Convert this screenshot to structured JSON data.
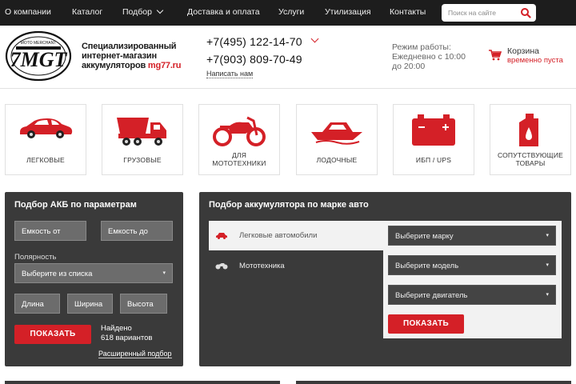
{
  "nav": {
    "items": [
      "О компании",
      "Каталог",
      "Подбор",
      "Доставка и оплата",
      "Услуги",
      "Утилизация",
      "Контакты"
    ],
    "search_placeholder": "Поиск на сайте"
  },
  "header": {
    "logo_text": "7MGT",
    "logo_arc_text": "MOTO MERCHANT",
    "tagline_line1": "Специализированный",
    "tagline_line2": "интернет-магазин",
    "tagline_line3_prefix": "аккумуляторов ",
    "tagline_line3_brand": "mg77.ru",
    "phone1": "+7(495) 122-14-70",
    "phone2": "+7(903) 809-70-49",
    "write_us": "Написать нам",
    "hours_line1": "Режим работы:",
    "hours_line2": "Ежедневно с 10:00",
    "hours_line3": "до 20:00",
    "cart_title": "Корзина",
    "cart_status": "временно пуста"
  },
  "categories": [
    {
      "label1": "ЛЕГКОВЫЕ",
      "label2": ""
    },
    {
      "label1": "ГРУЗОВЫЕ",
      "label2": ""
    },
    {
      "label1": "ДЛЯ",
      "label2": "МОТОТЕХНИКИ"
    },
    {
      "label1": "ЛОДОЧНЫЕ",
      "label2": ""
    },
    {
      "label1": "ИБП / UPS",
      "label2": ""
    },
    {
      "label1": "СОПУТСТВУЮЩИЕ",
      "label2": "ТОВАРЫ"
    }
  ],
  "param_panel": {
    "title": "Подбор АКБ по параметрам",
    "capacity_from": "Емкость от",
    "capacity_to": "Емкость до",
    "polarity_label": "Полярность",
    "polarity_value": "Выберите из списка",
    "length": "Длина",
    "width": "Ширина",
    "height": "Высота",
    "show_button": "ПОКАЗАТЬ",
    "found_line1": "Найдено",
    "found_line2": "618 вариантов",
    "extended_link": "Расширенный подбор"
  },
  "brand_panel": {
    "title": "Подбор аккумулятора по марке авто",
    "tab_cars": "Легковые автомобили",
    "tab_moto": "Мототехника",
    "select_brand": "Выберите марку",
    "select_model": "Выберите модель",
    "select_engine": "Выберите двигатель",
    "show_button": "ПОКАЗАТЬ"
  },
  "colors": {
    "accent": "#d42027",
    "dark": "#1d1d1d",
    "panel": "#3a3a3a"
  }
}
